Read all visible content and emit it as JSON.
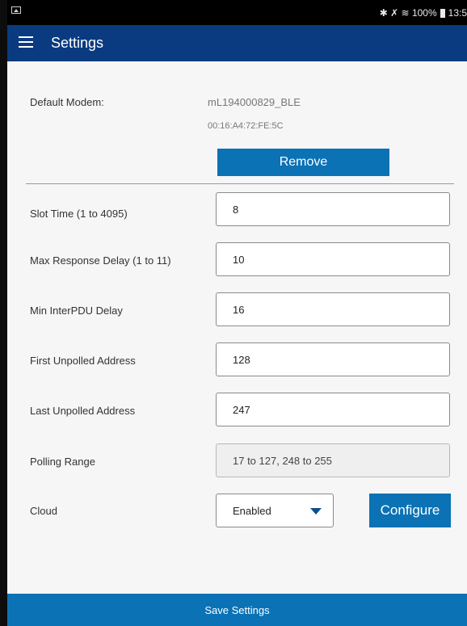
{
  "status_bar": {
    "right_text": "✱ ✗ ≋ 100%",
    "time": "13:5"
  },
  "app_bar": {
    "title": "Settings"
  },
  "modem": {
    "label": "Default Modem:",
    "name": "mL194000829_BLE",
    "mac": "00:16:A4:72:FE:5C",
    "remove_label": "Remove"
  },
  "fields": [
    {
      "label": "Slot Time (1 to 4095)",
      "value": "8"
    },
    {
      "label": "Max Response Delay (1 to 11)",
      "value": "10"
    },
    {
      "label": "Min InterPDU Delay",
      "value": "16"
    },
    {
      "label": "First Unpolled Address",
      "value": "128"
    },
    {
      "label": "Last Unpolled Address",
      "value": "247"
    },
    {
      "label": "Polling Range",
      "value": "17 to 127, 248 to 255"
    }
  ],
  "cloud": {
    "label": "Cloud",
    "selected": "Enabled",
    "configure_label": "Configure"
  },
  "footer": {
    "save_label": "Save Settings"
  },
  "colors": {
    "app_bar": "#0a3b80",
    "button": "#0b72b5",
    "background": "#f6f6f6"
  },
  "icons": [
    "picture-icon",
    "bluetooth-icon",
    "mute-icon",
    "wifi-icon",
    "battery-icon",
    "menu-icon",
    "chevron-down-icon"
  ]
}
